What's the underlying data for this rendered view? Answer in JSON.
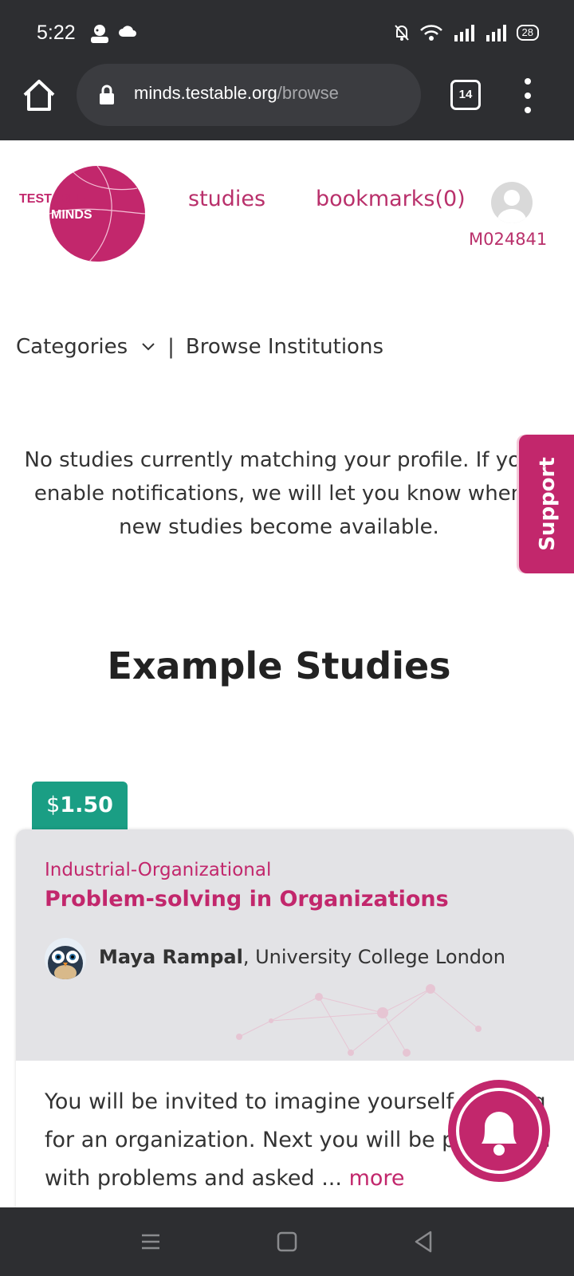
{
  "status_bar": {
    "time": "5:22",
    "battery": "28",
    "icons": [
      "person-icon",
      "cloud-icon",
      "bell-off-icon",
      "wifi-icon",
      "signal-icon",
      "signal-icon",
      "battery-icon"
    ]
  },
  "browser": {
    "url_domain": "minds.testable.org",
    "url_path": "/browse",
    "tab_count": "14"
  },
  "header": {
    "logo_line1": "TESTABLE",
    "logo_line2": "MINDS",
    "nav_studies": "studies",
    "nav_bookmarks": "bookmarks(0)",
    "user_id": "M024841"
  },
  "filters": {
    "categories": "Categories",
    "separator": "|",
    "browse_institutions": "Browse Institutions"
  },
  "notice": "No studies currently matching your profile. If you enable notifications, we will let you know when new studies become available.",
  "support_label": "Support",
  "section_title": "Example Studies",
  "study": {
    "price_symbol": "$",
    "price_value": "1.50",
    "category": "Industrial-Organizational",
    "title": "Problem-solving in Organizations",
    "author": "Maya Rampal",
    "institution": ", University College London",
    "description": "You will be invited to imagine yourself working for an organization. Next you will be presented with problems and asked ... ",
    "more": "more"
  },
  "colors": {
    "brand": "#c2276c",
    "price_badge": "#1a9e84",
    "chrome_dark": "#2d2e31"
  }
}
